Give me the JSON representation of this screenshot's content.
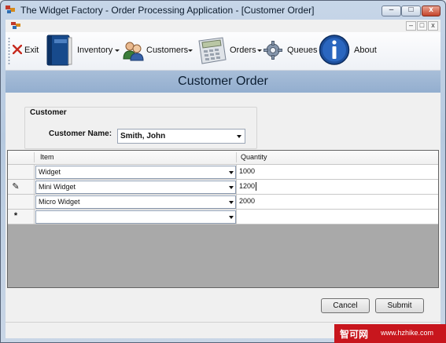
{
  "window": {
    "title": "The Widget Factory - Order Processing Application - [Customer Order]"
  },
  "title_buttons": {
    "minimize": "–",
    "maximize": "□",
    "close": "x"
  },
  "mdi_buttons": {
    "minimize": "–",
    "restore": "□",
    "close": "x"
  },
  "toolbar": {
    "exit": "Exit",
    "inventory": "Inventory",
    "customers": "Customers",
    "orders": "Orders",
    "queues": "Queues",
    "about": "About"
  },
  "banner": {
    "title": "Customer Order"
  },
  "customer_group": {
    "label": "Customer",
    "name_label": "Customer Name:",
    "name_value": "Smith, John"
  },
  "grid": {
    "columns": [
      "Item",
      "Quantity"
    ],
    "rows": [
      {
        "indicator": "",
        "item": "Widget",
        "quantity": "1000"
      },
      {
        "indicator": "✎",
        "item": "Mini Widget",
        "quantity": "1200"
      },
      {
        "indicator": "",
        "item": "Micro Widget",
        "quantity": "2000"
      },
      {
        "indicator": "*",
        "item": "",
        "quantity": ""
      }
    ]
  },
  "buttons": {
    "cancel": "Cancel",
    "submit": "Submit"
  },
  "watermark": {
    "brand": "智可网",
    "url": "www.hzhike.com"
  },
  "colors": {
    "banner": "#9bb5d4",
    "watermark": "#c8161d"
  }
}
